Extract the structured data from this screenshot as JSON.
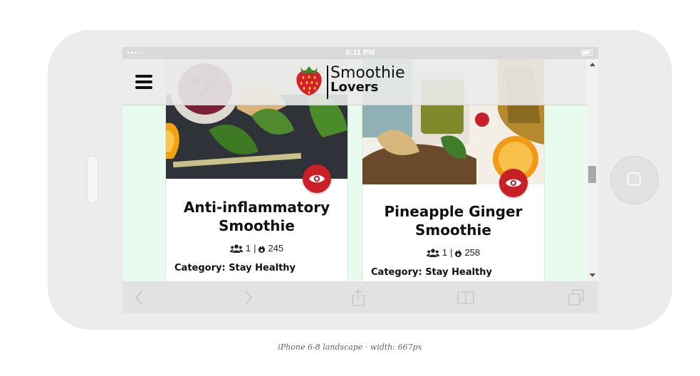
{
  "status_bar": {
    "time": "6:11 PM",
    "signal_dots": "●●●○○"
  },
  "header": {
    "menu_icon": "hamburger-menu-icon",
    "logo_icon": "strawberry-icon",
    "brand_line1": "Smoothie",
    "brand_line2": "Lovers"
  },
  "cards": [
    {
      "title_line1": "Anti-inflammatory",
      "title_line2": "Smoothie",
      "servings": "1",
      "calories": "245",
      "category": "Category: Stay Healthy",
      "view_icon": "eye-icon"
    },
    {
      "title_line1": "Pineapple Ginger",
      "title_line2": "Smoothie",
      "servings": "1",
      "calories": "258",
      "category": "Category: Stay Healthy",
      "view_icon": "eye-icon"
    }
  ],
  "meta_separator": "|",
  "toolbar": {
    "back_icon": "chevron-left-icon",
    "forward_icon": "chevron-right-icon",
    "share_icon": "share-icon",
    "bookmarks_icon": "book-icon",
    "tabs_icon": "tabs-icon"
  },
  "caption": "iPhone 6-8 landscape · width: 667px",
  "colors": {
    "accent_red": "#c91f26",
    "page_bg": "#e7fbef",
    "device": "#ececec"
  }
}
